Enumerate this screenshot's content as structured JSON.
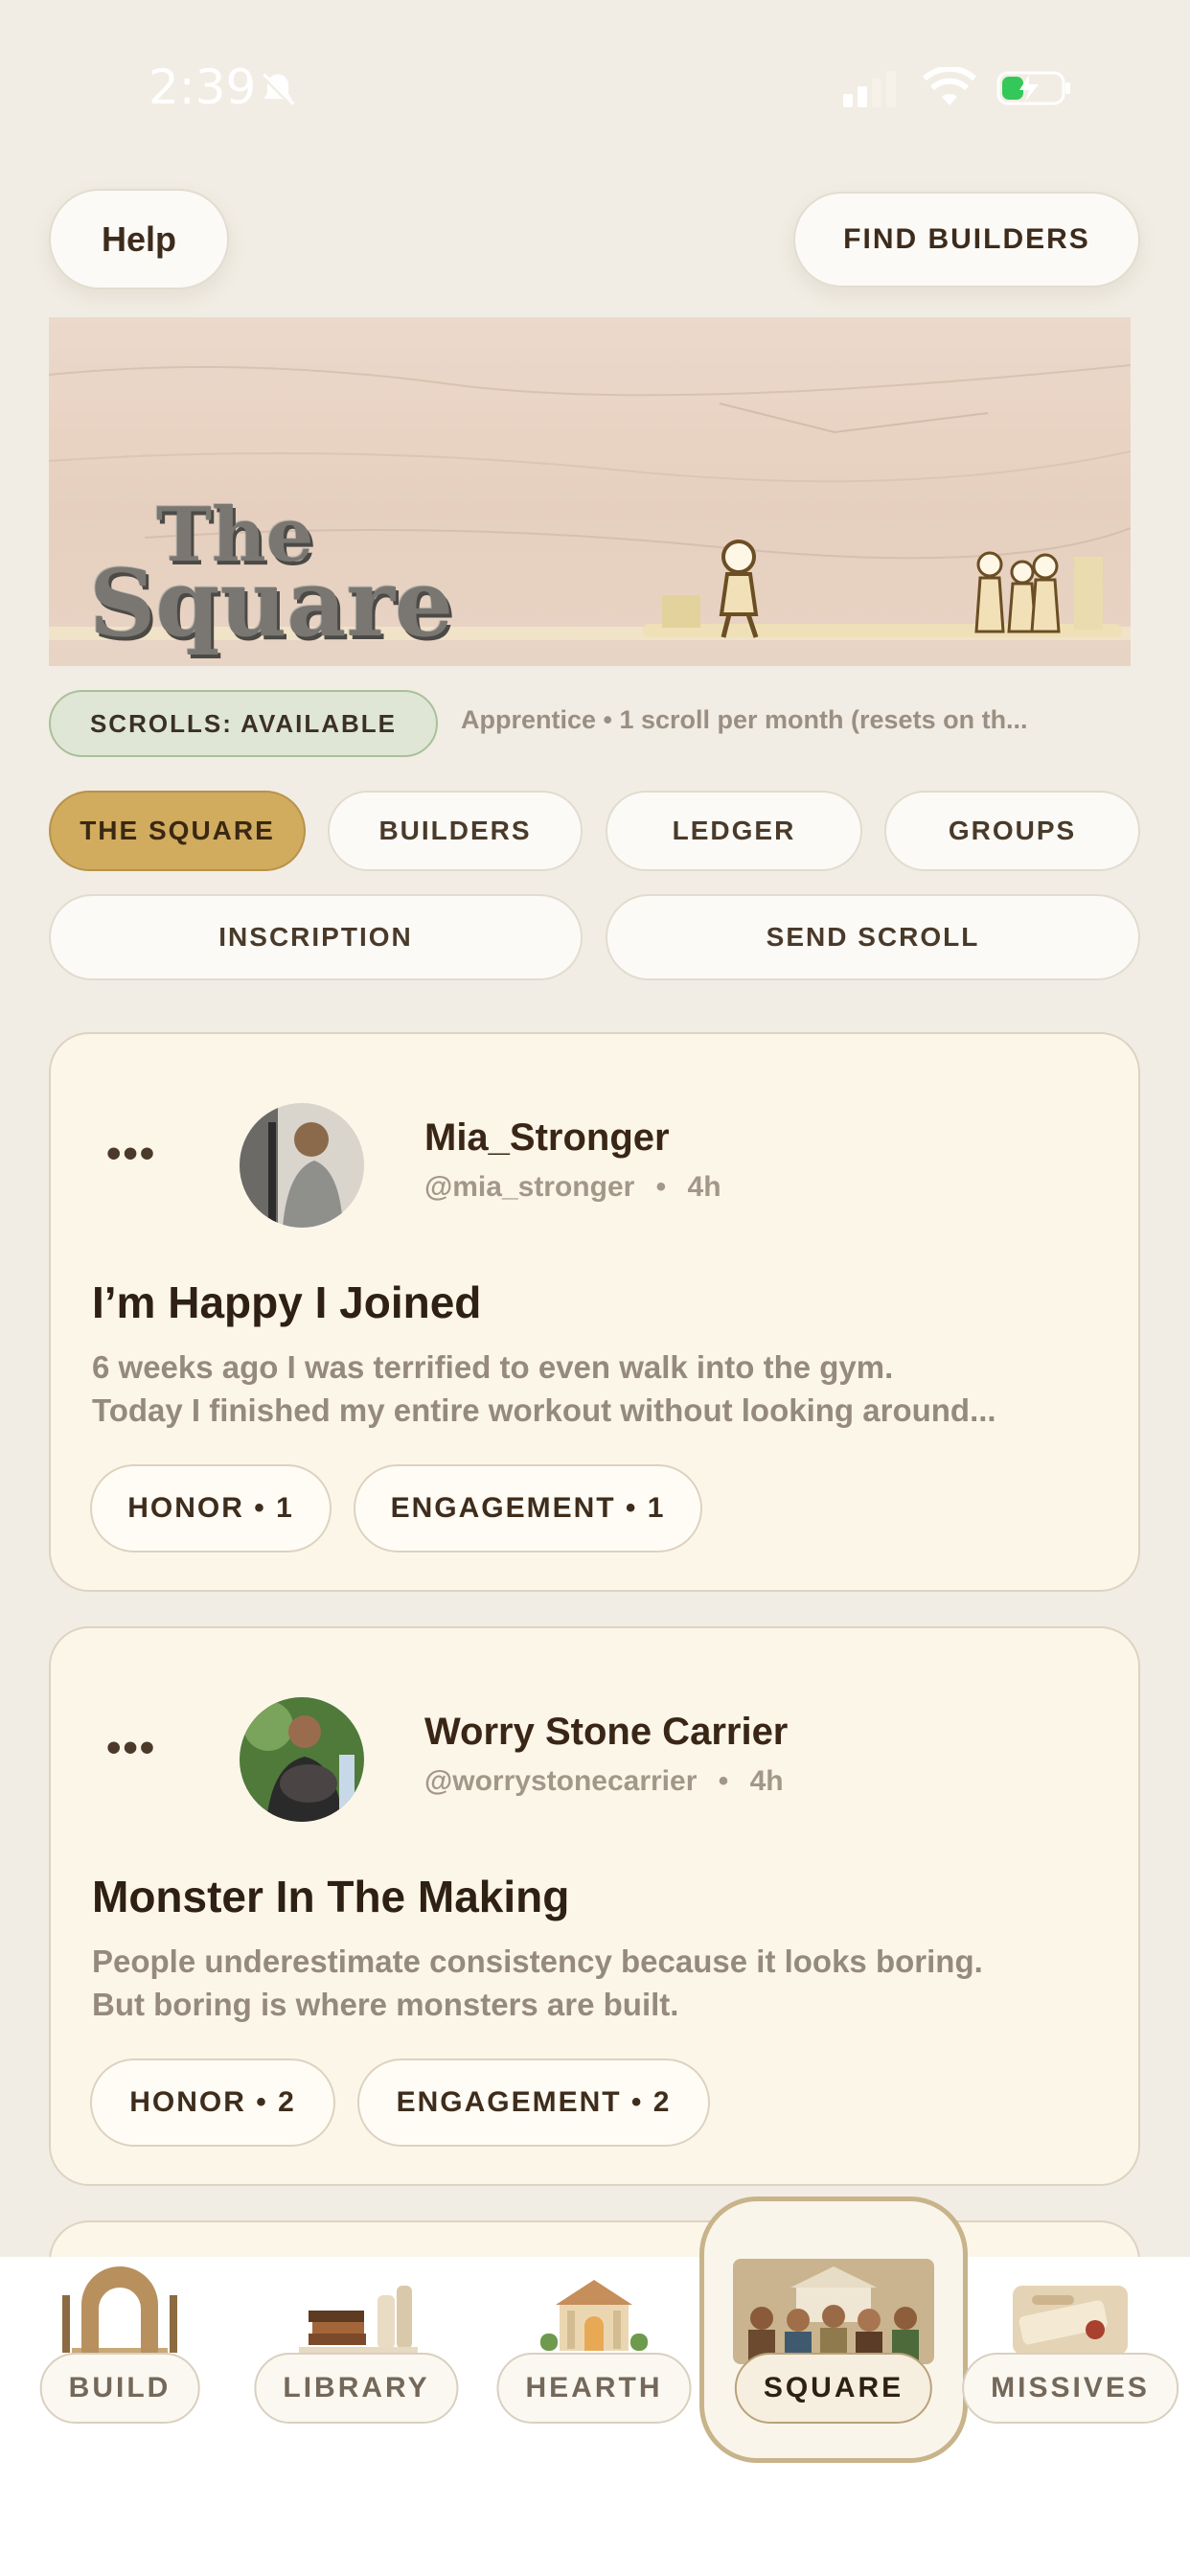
{
  "status_bar": {
    "time": "2:39"
  },
  "header": {
    "help_label": "Help",
    "find_builders_label": "FIND BUILDERS"
  },
  "banner": {
    "title_line1": "The",
    "title_line2": "Square"
  },
  "scrolls": {
    "badge": "SCROLLS: AVAILABLE",
    "note": "Apprentice • 1 scroll per month (resets on th..."
  },
  "tabs": [
    {
      "label": "THE SQUARE",
      "active": true
    },
    {
      "label": "BUILDERS",
      "active": false
    },
    {
      "label": "LEDGER",
      "active": false
    },
    {
      "label": "GROUPS",
      "active": false
    },
    {
      "label": "INSCRIPTION",
      "active": false
    },
    {
      "label": "SEND SCROLL",
      "active": false
    }
  ],
  "posts": [
    {
      "name": "Mia_Stronger",
      "handle": "@mia_stronger",
      "time": "4h",
      "title": "I’m Happy I Joined",
      "body_line1": "6 weeks ago I was terrified to even walk into the gym.",
      "body_line2": "Today I finished my entire workout without looking around...",
      "honor": "HONOR • 1",
      "engagement": "ENGAGEMENT • 1"
    },
    {
      "name": "Worry Stone Carrier",
      "handle": "@worrystonecarrier",
      "time": "4h",
      "title": "Monster In The Making",
      "body_line1": "People underestimate consistency because it looks boring.",
      "body_line2": "But boring is where monsters are built.",
      "honor": "HONOR • 2",
      "engagement": "ENGAGEMENT • 2"
    }
  ],
  "bottom_nav": [
    {
      "label": "BUILD",
      "icon": "arch-icon"
    },
    {
      "label": "LIBRARY",
      "icon": "books-icon"
    },
    {
      "label": "HEARTH",
      "icon": "temple-icon"
    },
    {
      "label": "SQUARE",
      "icon": "crowd-icon",
      "active": true
    },
    {
      "label": "MISSIVES",
      "icon": "scroll-icon"
    }
  ],
  "colors": {
    "background": "#f1ede4",
    "accent_gold": "#d1ab5e",
    "scroll_badge_green": "#dfe6d6",
    "card": "#fcf6e9"
  }
}
